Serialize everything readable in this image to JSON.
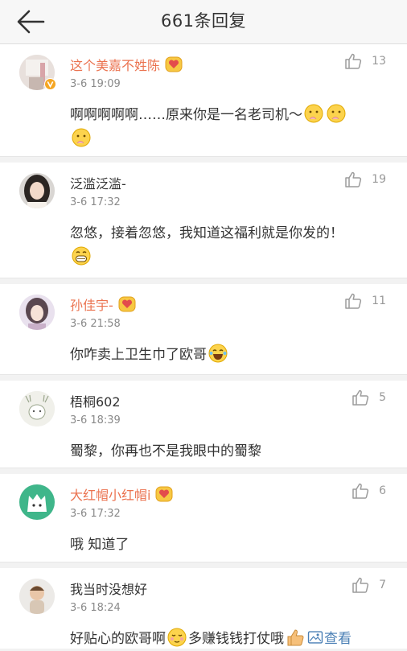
{
  "header": {
    "title": "661条回复"
  },
  "comments": [
    {
      "username": "这个美嘉不姓陈",
      "time": "3-6 19:09",
      "likes": "13",
      "text1": "啊啊啊啊啊……原来你是一名老司机～"
    },
    {
      "username": "泛滥泛滥-",
      "time": "3-6 17:32",
      "likes": "19",
      "text1": "忽悠，接着忽悠，我知道这福利就是你发的！"
    },
    {
      "username": "孙佳宇-",
      "time": "3-6 21:58",
      "likes": "11",
      "text1": "你咋卖上卫生巾了欧哥"
    },
    {
      "username": "梧桐602",
      "time": "3-6 18:39",
      "likes": "5",
      "text1": "蜀黎，你再也不是我眼中的蜀黎"
    },
    {
      "username": "大红帽小红帽i",
      "time": "3-6 17:32",
      "likes": "6",
      "text1": "哦 知道了"
    },
    {
      "username": "我当时没想好",
      "time": "3-6 18:24",
      "likes": "7",
      "text1": "好贴心的欧哥啊",
      "text2": "多赚钱钱打仗哦",
      "view_label": "查看"
    }
  ],
  "colors": {
    "username_orange": "#eb7350",
    "link_blue": "#4a7fb5",
    "muted": "#8a8a8a"
  },
  "icons": [
    "back-arrow-icon",
    "thumbs-up-icon",
    "vip-heart-icon",
    "verified-badge-icon",
    "emoji-icon",
    "image-icon"
  ]
}
